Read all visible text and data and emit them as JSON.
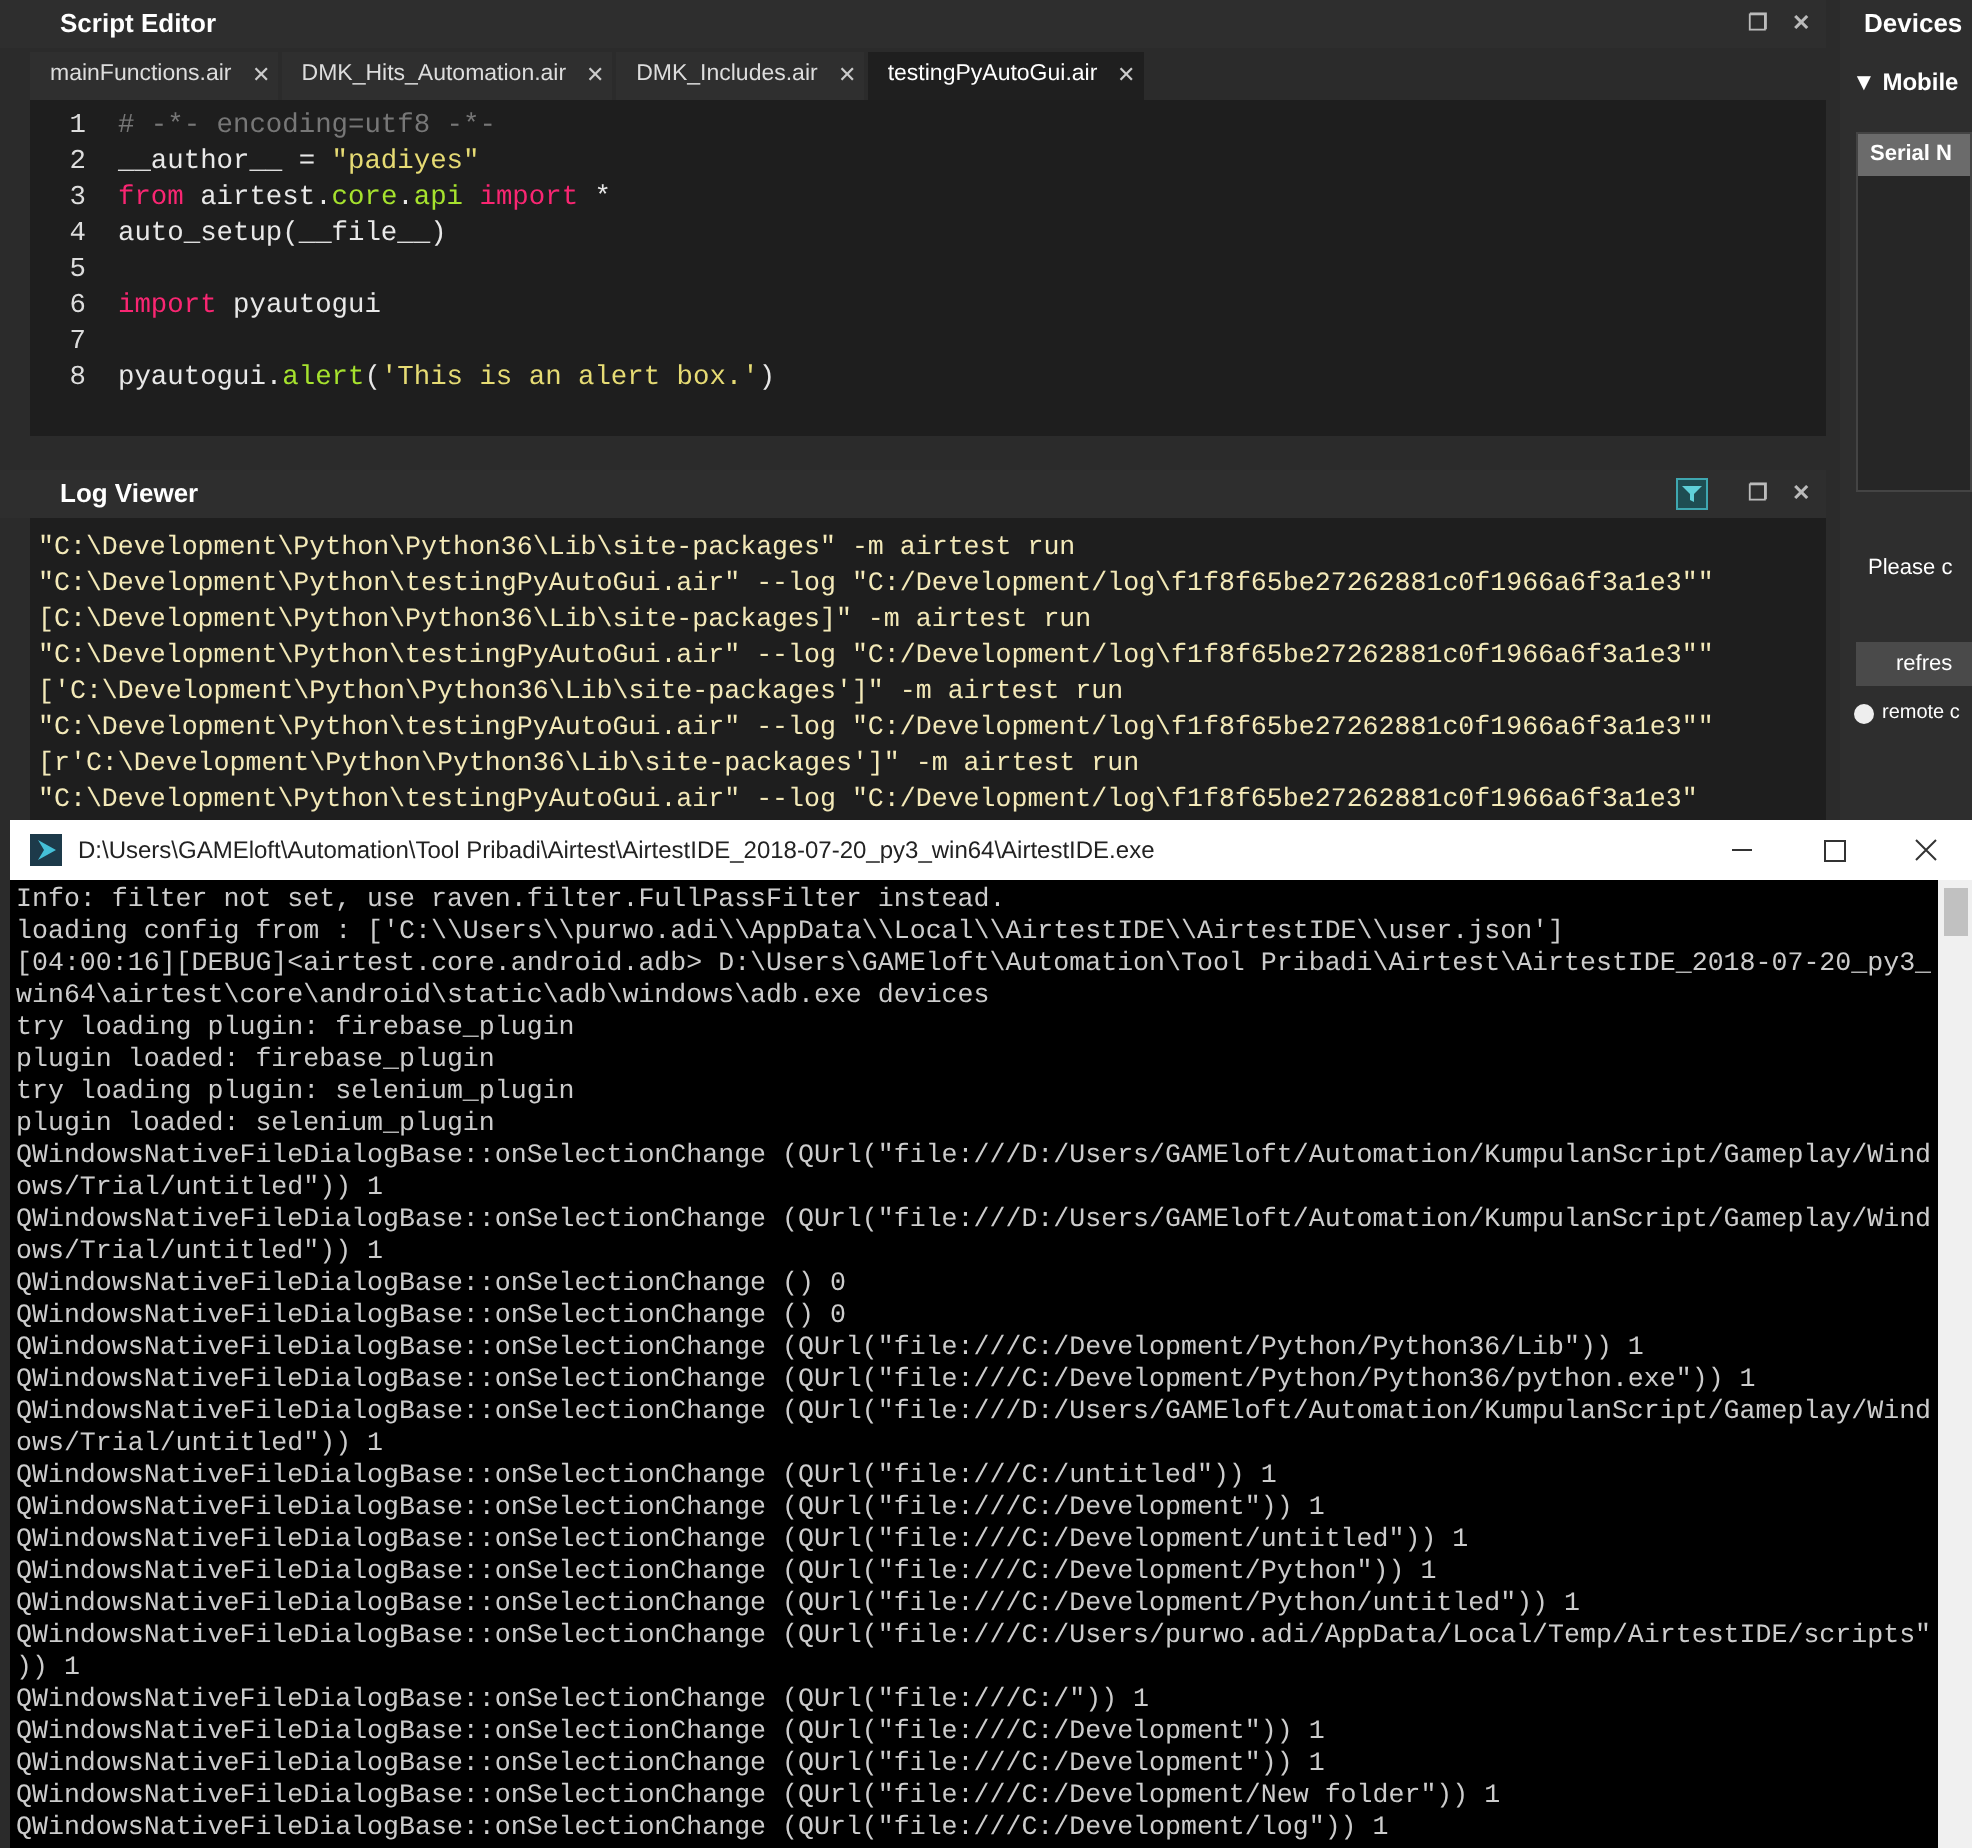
{
  "script_editor": {
    "title": "Script Editor",
    "restore": "❐",
    "close": "✕",
    "tabs": [
      {
        "label": "mainFunctions.air",
        "close": "✕",
        "selected": false
      },
      {
        "label": "DMK_Hits_Automation.air",
        "close": "✕",
        "selected": false
      },
      {
        "label": "DMK_Includes.air",
        "close": "✕",
        "selected": false
      },
      {
        "label": "testingPyAutoGui.air",
        "close": "✕",
        "selected": true
      }
    ],
    "lines": [
      {
        "number": "1",
        "tokens": [
          {
            "kind": "comment",
            "text": "# -*- encoding=utf8 -*-"
          }
        ]
      },
      {
        "number": "2",
        "tokens": [
          {
            "kind": "plain",
            "text": "__author__ = "
          },
          {
            "kind": "string",
            "text": "\"padiyes\""
          }
        ]
      },
      {
        "number": "3",
        "tokens": [
          {
            "kind": "keyword",
            "text": "from"
          },
          {
            "kind": "plain",
            "text": " airtest."
          },
          {
            "kind": "attr",
            "text": "core"
          },
          {
            "kind": "plain",
            "text": "."
          },
          {
            "kind": "attr",
            "text": "api"
          },
          {
            "kind": "keyword",
            "text": " import"
          },
          {
            "kind": "plain",
            "text": " *"
          }
        ]
      },
      {
        "number": "4",
        "tokens": [
          {
            "kind": "plain",
            "text": "auto_setup(__file__)"
          }
        ]
      },
      {
        "number": "5"
      },
      {
        "number": "6",
        "tokens": [
          {
            "kind": "keyword",
            "text": "import"
          },
          {
            "kind": "plain",
            "text": " pyautogui"
          }
        ]
      },
      {
        "number": "7"
      },
      {
        "number": "8",
        "tokens": [
          {
            "kind": "plain",
            "text": "pyautogui."
          },
          {
            "kind": "attr",
            "text": "alert"
          },
          {
            "kind": "plain",
            "text": "("
          },
          {
            "kind": "string",
            "text": "'This is an alert box.'"
          },
          {
            "kind": "plain",
            "text": ")"
          }
        ]
      }
    ]
  },
  "log_viewer": {
    "title": "Log Viewer",
    "restore": "❐",
    "close": "✕",
    "lines": [
      "\"C:\\Development\\Python\\Python36\\Lib\\site-packages\" -m airtest run",
      "\"C:\\Development\\Python\\testingPyAutoGui.air\" --log \"C:/Development/log\\f1f8f65be27262881c0f1966a6f3a1e3\"\"",
      "[C:\\Development\\Python\\Python36\\Lib\\site-packages]\" -m airtest run",
      "\"C:\\Development\\Python\\testingPyAutoGui.air\" --log \"C:/Development/log\\f1f8f65be27262881c0f1966a6f3a1e3\"\"",
      "['C:\\Development\\Python\\Python36\\Lib\\site-packages']\" -m airtest run",
      "\"C:\\Development\\Python\\testingPyAutoGui.air\" --log \"C:/Development/log\\f1f8f65be27262881c0f1966a6f3a1e3\"\"",
      "[r'C:\\Development\\Python\\Python36\\Lib\\site-packages']\" -m airtest run",
      "\"C:\\Development\\Python\\testingPyAutoGui.air\" --log \"C:/Development/log\\f1f8f65be27262881c0f1966a6f3a1e3\""
    ]
  },
  "devices": {
    "title": "Devices",
    "section": "▼ Mobile",
    "column": "Serial N",
    "message": "Please c",
    "button": "refres",
    "option": "remote c",
    "option_selected": false
  },
  "console": {
    "title": "D:\\Users\\GAMEloft\\Automation\\Tool Pribadi\\Airtest\\AirtestIDE_2018-07-20_py3_win64\\AirtestIDE.exe",
    "lines": [
      "Info: filter not set, use raven.filter.FullPassFilter instead.",
      "loading config from : ['C:\\\\Users\\\\purwo.adi\\\\AppData\\\\Local\\\\AirtestIDE\\\\AirtestIDE\\\\user.json']",
      "[04:00:16][DEBUG]<airtest.core.android.adb> D:\\Users\\GAMEloft\\Automation\\Tool Pribadi\\Airtest\\AirtestIDE_2018-07-20_py3_",
      "win64\\airtest\\core\\android\\static\\adb\\windows\\adb.exe devices",
      "try loading plugin: firebase_plugin",
      "plugin loaded: firebase_plugin",
      "try loading plugin: selenium_plugin",
      "plugin loaded: selenium_plugin",
      "QWindowsNativeFileDialogBase::onSelectionChange (QUrl(\"file:///D:/Users/GAMEloft/Automation/KumpulanScript/Gameplay/Wind",
      "ows/Trial/untitled\")) 1",
      "QWindowsNativeFileDialogBase::onSelectionChange (QUrl(\"file:///D:/Users/GAMEloft/Automation/KumpulanScript/Gameplay/Wind",
      "ows/Trial/untitled\")) 1",
      "QWindowsNativeFileDialogBase::onSelectionChange () 0",
      "QWindowsNativeFileDialogBase::onSelectionChange () 0",
      "QWindowsNativeFileDialogBase::onSelectionChange (QUrl(\"file:///C:/Development/Python/Python36/Lib\")) 1",
      "QWindowsNativeFileDialogBase::onSelectionChange (QUrl(\"file:///C:/Development/Python/Python36/python.exe\")) 1",
      "QWindowsNativeFileDialogBase::onSelectionChange (QUrl(\"file:///D:/Users/GAMEloft/Automation/KumpulanScript/Gameplay/Wind",
      "ows/Trial/untitled\")) 1",
      "QWindowsNativeFileDialogBase::onSelectionChange (QUrl(\"file:///C:/untitled\")) 1",
      "QWindowsNativeFileDialogBase::onSelectionChange (QUrl(\"file:///C:/Development\")) 1",
      "QWindowsNativeFileDialogBase::onSelectionChange (QUrl(\"file:///C:/Development/untitled\")) 1",
      "QWindowsNativeFileDialogBase::onSelectionChange (QUrl(\"file:///C:/Development/Python\")) 1",
      "QWindowsNativeFileDialogBase::onSelectionChange (QUrl(\"file:///C:/Development/Python/untitled\")) 1",
      "QWindowsNativeFileDialogBase::onSelectionChange (QUrl(\"file:///C:/Users/purwo.adi/AppData/Local/Temp/AirtestIDE/scripts\"",
      ")) 1",
      "QWindowsNativeFileDialogBase::onSelectionChange (QUrl(\"file:///C:/\")) 1",
      "QWindowsNativeFileDialogBase::onSelectionChange (QUrl(\"file:///C:/Development\")) 1",
      "QWindowsNativeFileDialogBase::onSelectionChange (QUrl(\"file:///C:/Development\")) 1",
      "QWindowsNativeFileDialogBase::onSelectionChange (QUrl(\"file:///C:/Development/New folder\")) 1",
      "QWindowsNativeFileDialogBase::onSelectionChange (QUrl(\"file:///C:/Development/log\")) 1"
    ]
  }
}
